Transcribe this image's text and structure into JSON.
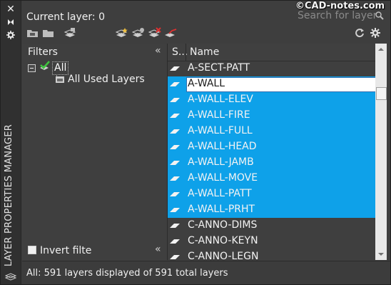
{
  "palette": {
    "accent": "#0ea1e9",
    "panel": "#3f3f3f",
    "text": "#f0f0f0"
  },
  "strip": {
    "title": "LAYER PROPERTIES MANAGER",
    "buttons": [
      {
        "icon": "close-icon",
        "glyph": "✕"
      },
      {
        "icon": "auto-hide-icon",
        "glyph": "⧗"
      },
      {
        "icon": "properties-icon",
        "glyph": "✲"
      }
    ]
  },
  "header": {
    "current_layer": "Current layer: 0",
    "search_placeholder": "Search for layer",
    "watermark": "©CAD-notes.com"
  },
  "toolbar": {
    "left": [
      "new-property-filter-icon",
      "new-group-filter-icon",
      "layer-states-manager-icon"
    ],
    "middle": [
      "new-layer-icon",
      "new-layer-vp-frozen-icon",
      "delete-layer-icon",
      "set-current-icon"
    ],
    "right": [
      "refresh-icon",
      "settings-icon"
    ]
  },
  "filters": {
    "title": "Filters",
    "tree": [
      {
        "label": "All",
        "expanded": true,
        "children": [
          {
            "label": "All Used Layers"
          }
        ]
      }
    ],
    "invert_label": "Invert filte",
    "invert_checked": false
  },
  "list": {
    "columns": [
      "S...",
      "Name"
    ],
    "rows": [
      {
        "name": "A-SECT-PATT",
        "selected": false
      },
      {
        "name": "A-WALL",
        "selected": true,
        "focused": true
      },
      {
        "name": "A-WALL-ELEV",
        "selected": true
      },
      {
        "name": "A-WALL-FIRE",
        "selected": true
      },
      {
        "name": "A-WALL-FULL",
        "selected": true
      },
      {
        "name": "A-WALL-HEAD",
        "selected": true
      },
      {
        "name": "A-WALL-JAMB",
        "selected": true
      },
      {
        "name": "A-WALL-MOVE",
        "selected": true
      },
      {
        "name": "A-WALL-PATT",
        "selected": true
      },
      {
        "name": "A-WALL-PRHT",
        "selected": true
      },
      {
        "name": "C-ANNO-DIMS",
        "selected": false
      },
      {
        "name": "C-ANNO-KEYN",
        "selected": false
      },
      {
        "name": "C-ANNO-LEGN",
        "selected": false
      }
    ]
  },
  "status": "All: 591 layers displayed of 591 total layers"
}
